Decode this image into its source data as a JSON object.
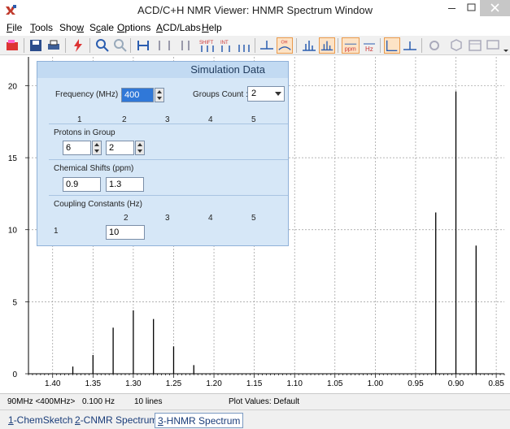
{
  "window": {
    "title": "ACD/C+H NMR Viewer: HNMR Spectrum Window"
  },
  "menu": {
    "items": [
      {
        "ul": "F",
        "rest": "ile"
      },
      {
        "ul": "T",
        "rest": "ools"
      },
      {
        "pre": "Sho",
        "ul": "w",
        "rest": ""
      },
      {
        "pre": "S",
        "ul": "c",
        "rest": "ale"
      },
      {
        "ul": "O",
        "rest": "ptions"
      },
      {
        "ul": "A",
        "rest": "CD/Labs"
      },
      {
        "ul": "H",
        "rest": "elp"
      }
    ]
  },
  "toolbar": {
    "shift_label": "SHIFT",
    "int_label": "INT",
    "ppm_label": "ppm",
    "hz_label": "Hz",
    "oh_label": "OH"
  },
  "sim": {
    "title": "Simulation Data",
    "frequency_label": "Frequency (MHz) :",
    "frequency_value": "400",
    "groups_label": "Groups Count :",
    "groups_value": "2",
    "columns": [
      "1",
      "2",
      "3",
      "4",
      "5"
    ],
    "protons_label": "Protons in Group",
    "protons": [
      "6",
      "2"
    ],
    "shifts_label": "Chemical Shifts (ppm)",
    "shifts": [
      "0.9",
      "1.3"
    ],
    "coupling_label": "Coupling Constants (Hz)",
    "coupling_columns": [
      "2",
      "3",
      "4",
      "5"
    ],
    "coupling_row_label": "1",
    "coupling_value": "10"
  },
  "status": {
    "freq": "90MHz <400MHz>",
    "res": "0.100 Hz",
    "lines": "10 lines",
    "plot": "Plot Values: Default"
  },
  "tabs": [
    {
      "ul": "1",
      "rest": "-ChemSketch",
      "active": false
    },
    {
      "ul": "2",
      "rest": "-CNMR Spectrum",
      "active": false
    },
    {
      "ul": "3",
      "rest": "-HNMR Spectrum",
      "active": true
    }
  ],
  "chart_data": {
    "type": "line",
    "x_axis": {
      "ticks": [
        "1.40",
        "1.35",
        "1.30",
        "1.25",
        "1.20",
        "1.15",
        "1.10",
        "1.05",
        "1.00",
        "0.95",
        "0.90",
        "0.85"
      ],
      "range": [
        1.43,
        0.84
      ],
      "reversed": true
    },
    "y_axis": {
      "ticks": [
        "0",
        "5",
        "10",
        "15",
        "20"
      ],
      "range": [
        0,
        22
      ]
    },
    "grid": true,
    "peaks": [
      {
        "x": 1.375,
        "y": 0.5
      },
      {
        "x": 1.35,
        "y": 1.3
      },
      {
        "x": 1.325,
        "y": 3.2
      },
      {
        "x": 1.3,
        "y": 4.4
      },
      {
        "x": 1.275,
        "y": 3.8
      },
      {
        "x": 1.25,
        "y": 1.9
      },
      {
        "x": 1.225,
        "y": 0.6
      },
      {
        "x": 0.925,
        "y": 11.2
      },
      {
        "x": 0.9,
        "y": 19.6
      },
      {
        "x": 0.875,
        "y": 8.9
      }
    ]
  }
}
